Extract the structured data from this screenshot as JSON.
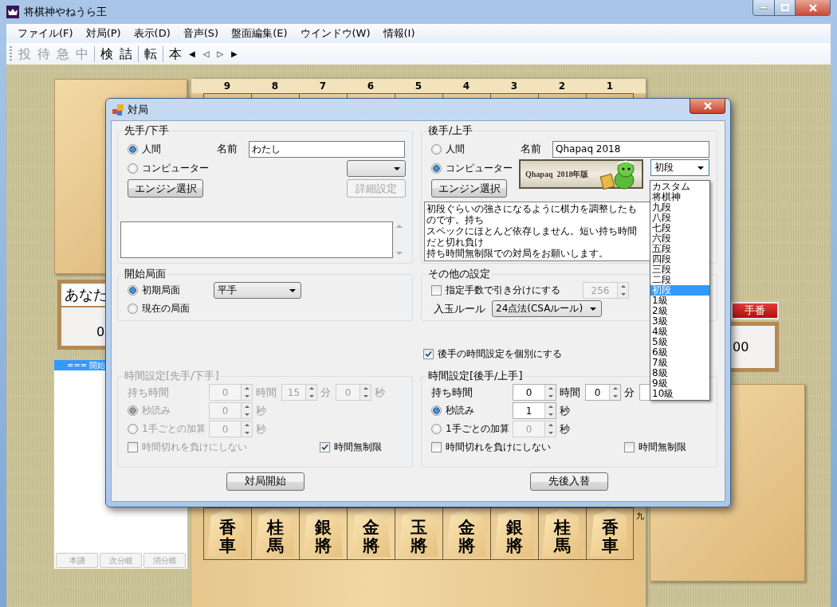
{
  "window": {
    "title": "将棋神やねうら王"
  },
  "menu": [
    "ファイル(F)",
    "対局(P)",
    "表示(D)",
    "音声(S)",
    "盤面編集(E)",
    "ウインドウ(W)",
    "情報(I)"
  ],
  "toolbar": [
    [
      {
        "label": "投",
        "disabled": true
      },
      {
        "label": "待",
        "disabled": true
      },
      {
        "label": "急",
        "disabled": true
      },
      {
        "label": "中",
        "disabled": true
      }
    ],
    [
      {
        "label": "検",
        "disabled": false
      },
      {
        "label": "詰",
        "disabled": false
      }
    ],
    [
      {
        "label": "転",
        "disabled": false
      }
    ],
    [
      {
        "label": "本",
        "disabled": false
      },
      {
        "label": "◀",
        "disabled": false
      },
      {
        "label": "◁",
        "disabled": false
      },
      {
        "label": "▷",
        "disabled": false
      },
      {
        "label": "▶",
        "disabled": false
      }
    ]
  ],
  "board": {
    "file_numbers": [
      "9",
      "8",
      "7",
      "6",
      "5",
      "4",
      "3",
      "2",
      "1"
    ],
    "rank_label": "九",
    "bottom_rank": [
      "香車",
      "桂馬",
      "銀將",
      "金將",
      "玉將",
      "金將",
      "銀將",
      "桂馬",
      "香車"
    ]
  },
  "sente_player": {
    "name": "あなた",
    "time": "0"
  },
  "gote_player": {
    "turn_label": "手番",
    "time": "00"
  },
  "kifu": {
    "rows": [
      {
        "text": "=== 開始",
        "selected": true
      }
    ],
    "buttons": [
      {
        "label": "本譜",
        "disabled": true
      },
      {
        "label": "次分岐",
        "disabled": true
      },
      {
        "label": "消分岐",
        "disabled": true
      }
    ]
  },
  "dialog": {
    "title": "対局",
    "sente": {
      "heading": "先手/下手",
      "radios": [
        {
          "label": "人間",
          "selected": true
        },
        {
          "label": "コンピューター",
          "selected": false
        }
      ],
      "name_label": "名前",
      "name_value": "わたし",
      "engine_button": "エンジン選択",
      "detail_button": {
        "label": "詳細設定",
        "disabled": true
      }
    },
    "gote": {
      "heading": "後手/上手",
      "radios": [
        {
          "label": "人間",
          "selected": false
        },
        {
          "label": "コンピューター",
          "selected": true
        }
      ],
      "name_label": "名前",
      "name_value": "Qhapaq 2018",
      "engine_button": "エンジン選択",
      "banner_text": "Qhapaq  2018年版",
      "level": "初段",
      "description": [
        "初段ぐらいの強さになるように棋力を調整したものです。持ち",
        "スペックにほとんど依存しません。短い持ち時間だと切れ負け",
        "持ち時間無制限での対局をお願いします。"
      ]
    },
    "start_position": {
      "heading": "開始局面",
      "radios": [
        {
          "label": "初期局面",
          "selected": true
        },
        {
          "label": "現在の局面",
          "selected": false
        }
      ],
      "handicap": "平手"
    },
    "other_settings": {
      "heading": "その他の設定",
      "draw_by_moves": {
        "label": "指定手数で引き分けにする",
        "checked": false,
        "value": "256"
      },
      "entering_king_label": "入玉ルール",
      "entering_king_rule": "24点法(CSAルール)"
    },
    "separate_time": {
      "label": "後手の時間設定を個別にする",
      "checked": true
    },
    "sente_time": {
      "heading": "時間設定[先手/下手]",
      "disabled": true,
      "limit_label": "持ち時間",
      "hours": "0",
      "hours_unit": "時間",
      "minutes": "15",
      "minutes_unit": "分",
      "seconds": "0",
      "seconds_unit": "秒",
      "modes": [
        {
          "label": "秒読み",
          "selected": true,
          "value": "0",
          "unit": "秒"
        },
        {
          "label": "1手ごとの加算",
          "selected": false,
          "value": "0",
          "unit": "秒"
        }
      ],
      "no_timeout_loss": {
        "label": "時間切れを負けにしない",
        "checked": false
      },
      "unlimited": {
        "label": "時間無制限",
        "checked": true
      }
    },
    "gote_time": {
      "heading": "時間設定[後手/上手]",
      "disabled": false,
      "limit_label": "持ち時間",
      "hours": "0",
      "hours_unit": "時間",
      "minutes": "0",
      "minutes_unit": "分",
      "modes": [
        {
          "label": "秒読み",
          "selected": true,
          "value": "1",
          "unit": "秒"
        },
        {
          "label": "1手ごとの加算",
          "selected": false,
          "value": "0",
          "unit": "秒"
        }
      ],
      "no_timeout_loss": {
        "label": "時間切れを負けにしない",
        "checked": false
      },
      "unlimited": {
        "label": "時間無制限",
        "checked": false
      }
    },
    "start_button": "対局開始",
    "swap_button": "先後入替"
  },
  "level_list": [
    {
      "label": "カスタム",
      "selected": false
    },
    {
      "label": "将棋神",
      "selected": false
    },
    {
      "label": "九段",
      "selected": false
    },
    {
      "label": "八段",
      "selected": false
    },
    {
      "label": "七段",
      "selected": false
    },
    {
      "label": "六段",
      "selected": false
    },
    {
      "label": "五段",
      "selected": false
    },
    {
      "label": "四段",
      "selected": false
    },
    {
      "label": "三段",
      "selected": false
    },
    {
      "label": "二段",
      "selected": false
    },
    {
      "label": "初段",
      "selected": true
    },
    {
      "label": "1級",
      "selected": false
    },
    {
      "label": "2級",
      "selected": false
    },
    {
      "label": "3級",
      "selected": false
    },
    {
      "label": "4級",
      "selected": false
    },
    {
      "label": "5級",
      "selected": false
    },
    {
      "label": "6級",
      "selected": false
    },
    {
      "label": "7級",
      "selected": false
    },
    {
      "label": "8級",
      "selected": false
    },
    {
      "label": "9級",
      "selected": false
    },
    {
      "label": "10級",
      "selected": false
    }
  ]
}
